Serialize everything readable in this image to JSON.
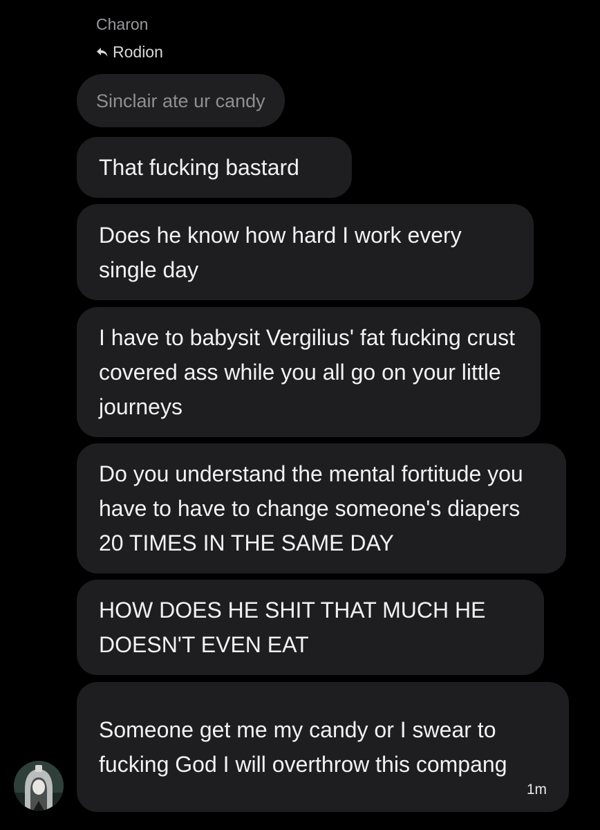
{
  "thread": {
    "sender_name": "Charon",
    "reply_to_name": "Rodion",
    "quoted_message": "Sinclair ate ur candy",
    "messages": [
      "That fucking bastard",
      "Does he know how hard I work every single day",
      "I have to babysit Vergilius' fat fucking crust covered ass while you all go on your little journeys",
      "Do you understand the mental fortitude you have to have to change someone's diapers 20 TIMES IN THE SAME DAY",
      "HOW DOES HE SHIT THAT MUCH HE DOESN'T EVEN EAT",
      "Someone get me my candy or I swear to fucking God I will overthrow this compang"
    ],
    "last_timestamp": "1m"
  },
  "icons": {
    "reply": "reply-arrow-icon",
    "avatar": "sender-avatar"
  },
  "colors": {
    "background": "#000000",
    "bubble": "#1e1e20",
    "text": "#f2f2f4",
    "muted_text": "#9a9a9e"
  }
}
